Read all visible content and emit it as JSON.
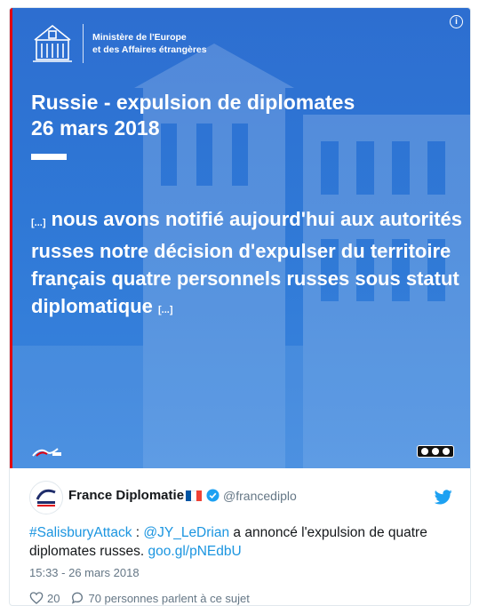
{
  "media": {
    "ministry_line1": "Ministère de l'Europe",
    "ministry_line2": "et des Affaires étrangères",
    "title_line1": "Russie - expulsion de diplomates",
    "title_line2": "26 mars 2018",
    "quote_ellipsis_start": "[...]",
    "quote_text": "nous avons notifié aujourd'hui aux autorités russes notre décision d'expulser du territoire français quatre personnels russes sous statut diplomatique",
    "quote_ellipsis_end": "[...]",
    "info_glyph": "i",
    "accent_color": "#2f78d6",
    "stripe_color": "#e1000f"
  },
  "tweet": {
    "author_name": "France Diplomatie",
    "handle": "@francediplo",
    "hashtag": "#SalisburyAttack",
    "separator": " : ",
    "mention": "@JY_LeDrian",
    "text": " a annoncé l'expulsion de quatre diplomates russes. ",
    "link": "goo.gl/pNEdbU",
    "timestamp": "15:33 - 26 mars 2018",
    "likes": "20",
    "replies_text": "70 personnes parlent à ce sujet",
    "link_color": "#1b95e0"
  }
}
